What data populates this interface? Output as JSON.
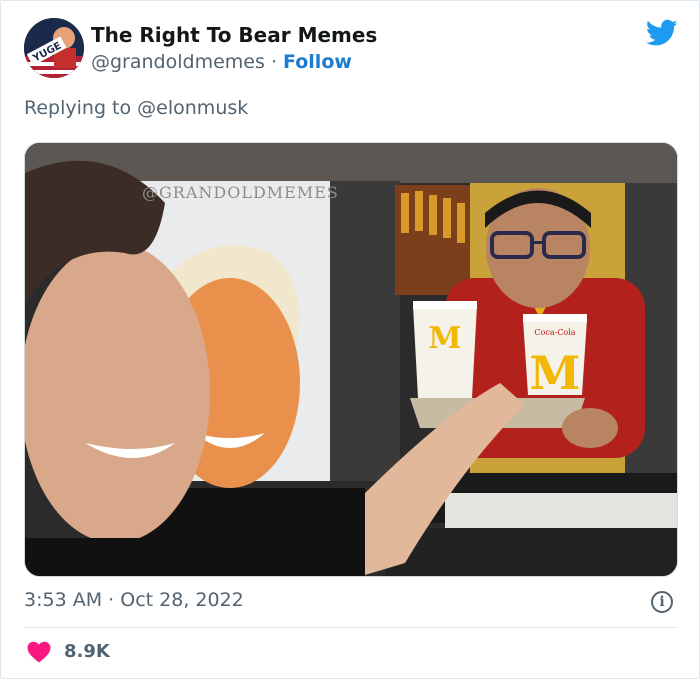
{
  "tweet": {
    "author_name": "The Right To Bear Memes",
    "handle": "@grandoldmemes",
    "separator": "·",
    "follow_label": "Follow",
    "avatar_text": "YUGE",
    "reply_prefix": "Replying to",
    "reply_to": "@elonmusk",
    "media": {
      "watermark": "@GRANDOLDMEMES",
      "cup_logo": "M",
      "cup_brand": "Coca-Cola"
    },
    "time": "3:53 AM",
    "date": "Oct 28, 2022",
    "time_separator": "·",
    "likes": "8.9K"
  },
  "colors": {
    "link_blue": "#1d7bd0",
    "twitter_blue": "#1d9bf0",
    "like_pink": "#f91880",
    "muted_text": "#536471",
    "heading_text": "#14171a"
  },
  "icons": {
    "brand": "twitter-bird-icon",
    "info": "info-icon",
    "like": "heart-icon"
  }
}
